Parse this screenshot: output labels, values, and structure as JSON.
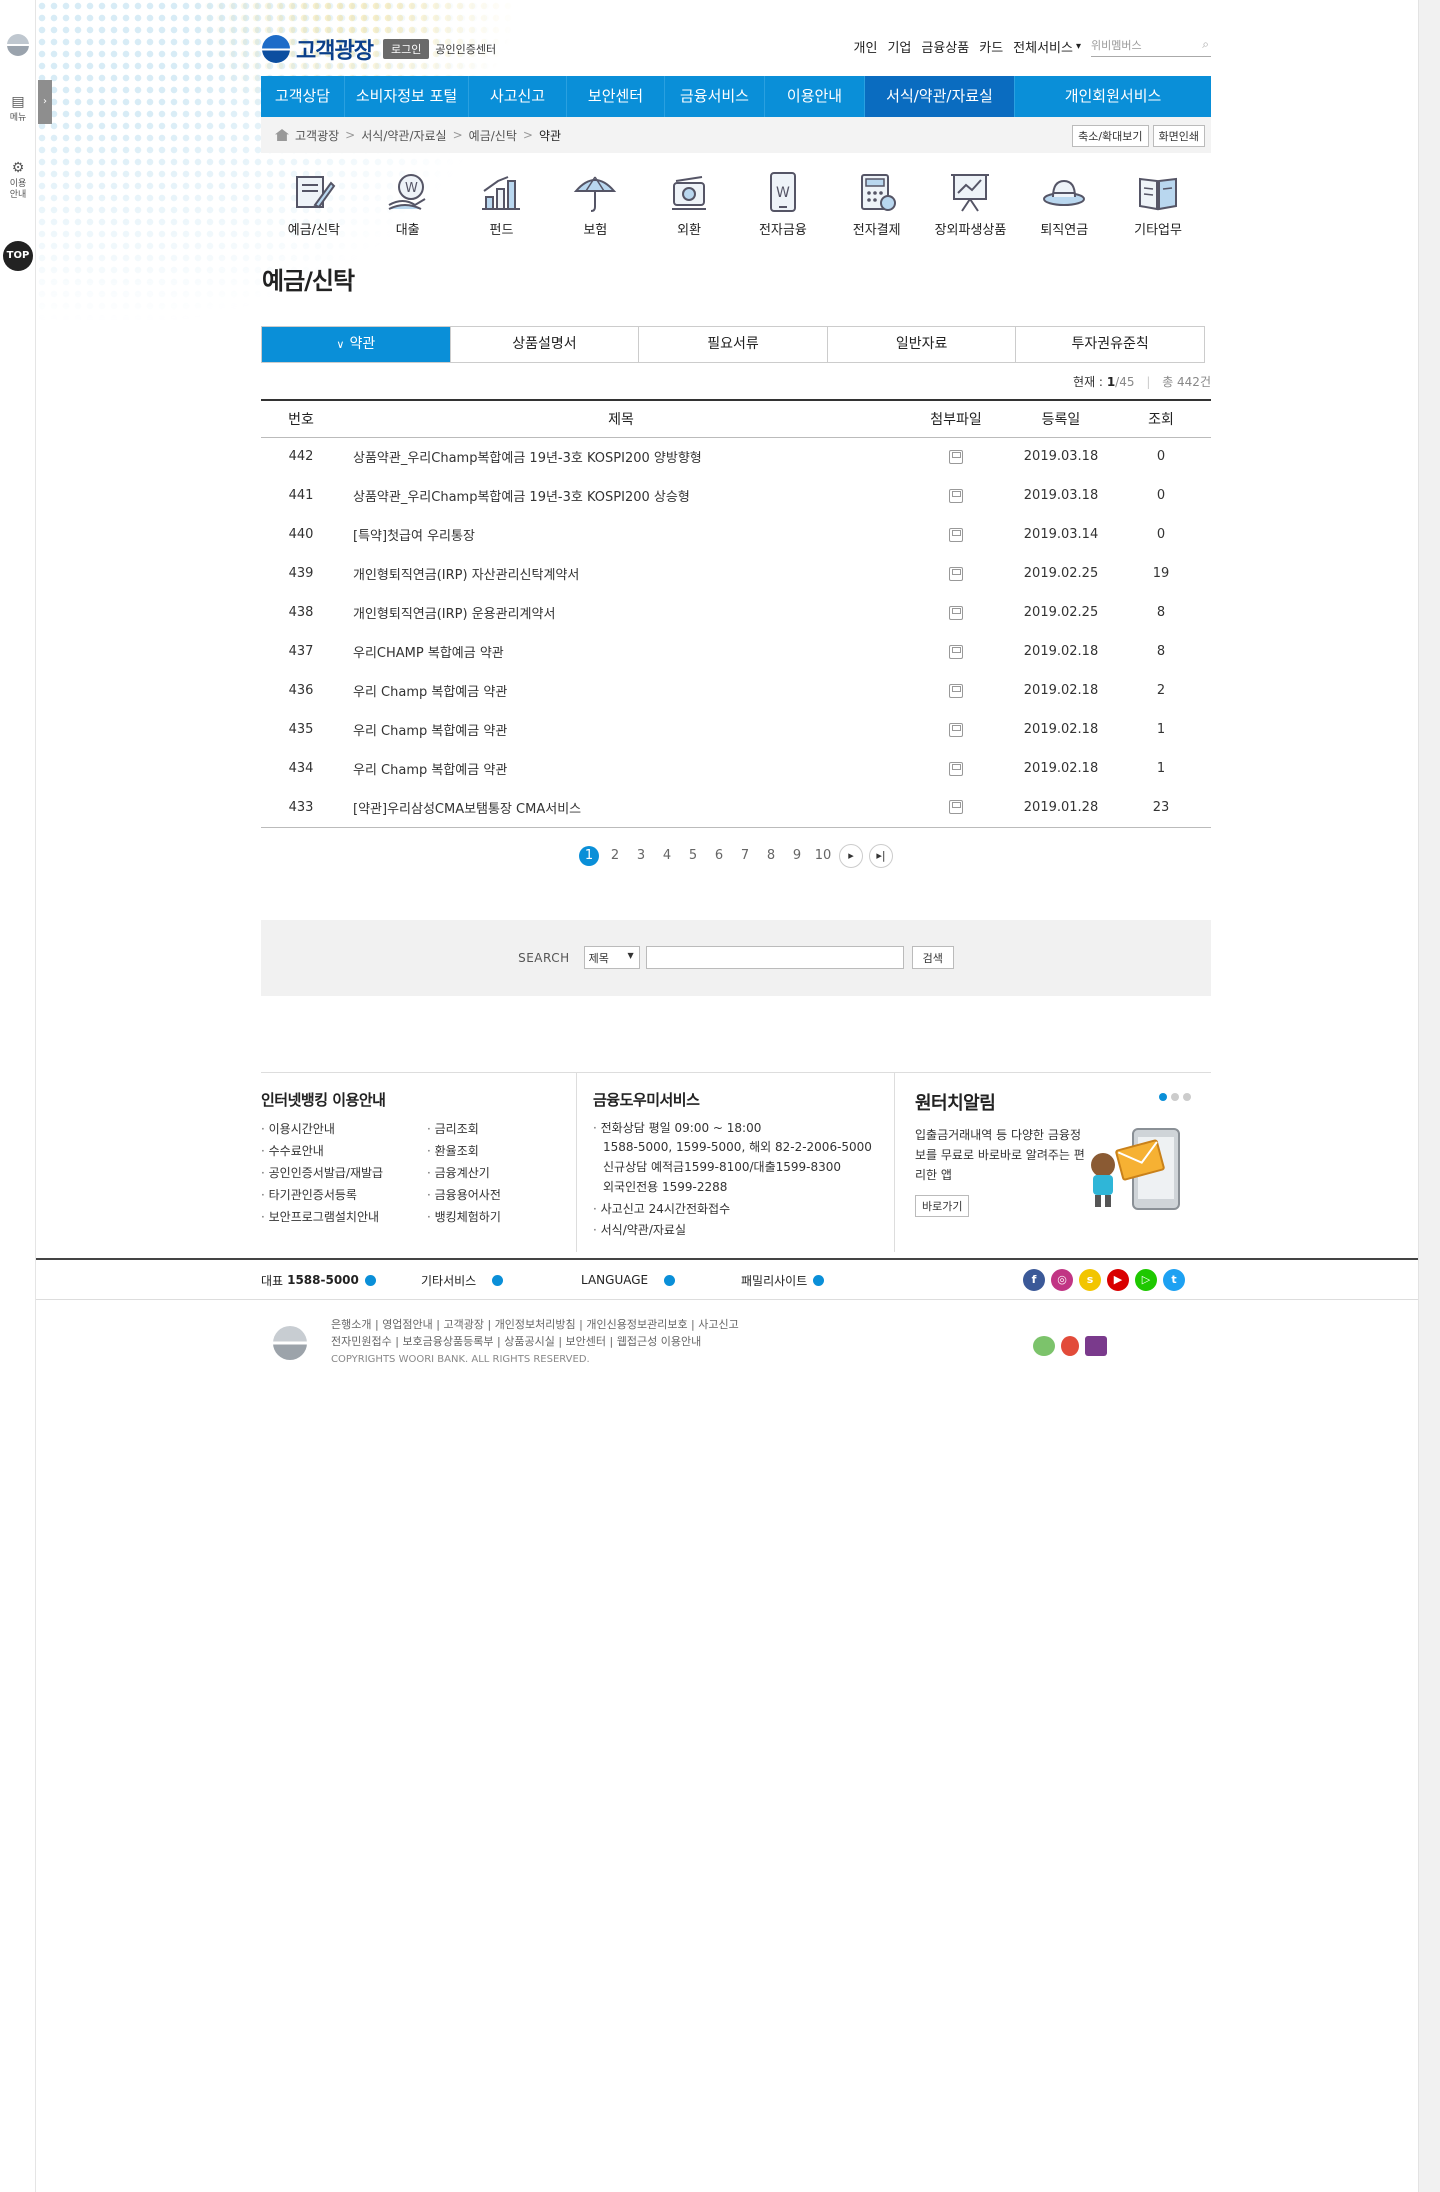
{
  "brand": {
    "logo_text": "고객광장",
    "login_label": "로그인",
    "cert_label": "공인인증센터"
  },
  "util_nav": {
    "items": [
      "개인",
      "기업",
      "금융상품",
      "카드",
      "전체서비스"
    ],
    "dropdown_caret": "▾",
    "search_placeholder": "위비멤버스"
  },
  "gnb": {
    "items": [
      "고객상담",
      "소비자정보 포털",
      "사고신고",
      "보안센터",
      "금융서비스",
      "이용안내",
      "서식/약관/자료실",
      "개인회원서비스"
    ],
    "active_index": 6,
    "active_color": "#0a6cc0",
    "bar_color": "#0a8fd8"
  },
  "breadcrumb": {
    "items": [
      "고객광장",
      "서식/약관/자료실",
      "예금/신탁",
      "약관"
    ],
    "separator": ">",
    "zoom_label": "축소/확대보기",
    "print_label": "화면인쇄"
  },
  "left_rail": {
    "menu_label": "메뉴",
    "guide_label": "이용 안내",
    "top_label": "TOP",
    "toggle": "›"
  },
  "categories": [
    {
      "label": "예금/신탁",
      "icon": "deposit-icon"
    },
    {
      "label": "대출",
      "icon": "loan-icon"
    },
    {
      "label": "펀드",
      "icon": "fund-icon"
    },
    {
      "label": "보험",
      "icon": "insurance-icon"
    },
    {
      "label": "외환",
      "icon": "forex-icon"
    },
    {
      "label": "전자금융",
      "icon": "e-banking-icon"
    },
    {
      "label": "전자결제",
      "icon": "e-payment-icon"
    },
    {
      "label": "장외파생상품",
      "icon": "derivatives-icon"
    },
    {
      "label": "퇴직연금",
      "icon": "pension-icon"
    },
    {
      "label": "기타업무",
      "icon": "other-work-icon"
    }
  ],
  "page_title": "예금/신탁",
  "tabs": {
    "items": [
      "약관",
      "상품설명서",
      "필요서류",
      "일반자료",
      "투자권유준칙"
    ],
    "active_index": 0,
    "active_marker": "∨"
  },
  "count": {
    "current_label": "현재 :",
    "current_page": "1",
    "total_pages": "/45",
    "total_label": "총 442건"
  },
  "table": {
    "headers": [
      "번호",
      "제목",
      "첨부파일",
      "등록일",
      "조회"
    ],
    "rows": [
      {
        "num": "442",
        "title": "상품약관_우리Champ복합예금 19년-3호 KOSPI200 양방향형",
        "date": "2019.03.18",
        "views": "0"
      },
      {
        "num": "441",
        "title": "상품약관_우리Champ복합예금 19년-3호 KOSPI200 상승형",
        "date": "2019.03.18",
        "views": "0"
      },
      {
        "num": "440",
        "title": "[특약]첫급여 우리통장",
        "date": "2019.03.14",
        "views": "0"
      },
      {
        "num": "439",
        "title": "개인형퇴직연금(IRP) 자산관리신탁계약서",
        "date": "2019.02.25",
        "views": "19"
      },
      {
        "num": "438",
        "title": "개인형퇴직연금(IRP) 운용관리계약서",
        "date": "2019.02.25",
        "views": "8"
      },
      {
        "num": "437",
        "title": "우리CHAMP 복합예금 약관",
        "date": "2019.02.18",
        "views": "8"
      },
      {
        "num": "436",
        "title": "우리 Champ 복합예금 약관",
        "date": "2019.02.18",
        "views": "2"
      },
      {
        "num": "435",
        "title": "우리 Champ 복합예금 약관",
        "date": "2019.02.18",
        "views": "1"
      },
      {
        "num": "434",
        "title": "우리 Champ 복합예금 약관",
        "date": "2019.02.18",
        "views": "1"
      },
      {
        "num": "433",
        "title": "[약관]우리삼성CMA보탬통장 CMA서비스",
        "date": "2019.01.28",
        "views": "23"
      }
    ]
  },
  "pager": {
    "pages": [
      "1",
      "2",
      "3",
      "4",
      "5",
      "6",
      "7",
      "8",
      "9",
      "10"
    ],
    "current": "1",
    "next": "▸",
    "last": "▸|"
  },
  "search": {
    "label": "SEARCH",
    "select_value": "제목",
    "caret": "▼",
    "button": "검색"
  },
  "info": {
    "banking_title": "인터넷뱅킹 이용안내",
    "banking_links": [
      "이용시간안내",
      "금리조회",
      "수수료안내",
      "환율조회",
      "공인인증서발급/재발급",
      "금융계산기",
      "타기관인증서등록",
      "금융용어사전",
      "보안프로그램설치안내",
      "뱅킹체험하기"
    ],
    "helper_title": "금융도우미서비스",
    "helper_phone_title": "전화상담 평일 09:00 ~ 18:00",
    "helper_phone_lines": [
      "1588-5000, 1599-5000, 해외 82-2-2006-5000",
      "신규상담 예적금1599-8100/대출1599-8300",
      "외국인전용 1599-2288"
    ],
    "helper_accident": "사고신고 24시간전화접수",
    "helper_forms": "서식/약관/자료실",
    "alarm_title": "원터치알림",
    "alarm_text": "입출금거래내역 등 다양한 금융정보를 무료로 바로바로 알려주는 편리한 앱",
    "alarm_button": "바로가기"
  },
  "footer_bar": {
    "rep_label": "대표",
    "rep_phone": "1588-5000",
    "other_label": "기타서비스",
    "language_label": "LANGUAGE",
    "family_label": "패밀리사이트",
    "sns": [
      {
        "name": "facebook-icon",
        "glyph": "f",
        "color": "#3b5998"
      },
      {
        "name": "instagram-icon",
        "glyph": "◎",
        "color": "#c13584"
      },
      {
        "name": "kakaostory-icon",
        "glyph": "s",
        "color": "#f2c500"
      },
      {
        "name": "youtube-icon",
        "glyph": "▶",
        "color": "#d90000"
      },
      {
        "name": "naver-tv-icon",
        "glyph": "▷",
        "color": "#1ec800"
      },
      {
        "name": "twitter-icon",
        "glyph": "t",
        "color": "#1da1f2"
      }
    ]
  },
  "footer": {
    "links_row1": [
      "은행소개",
      "영업점안내",
      "고객광장",
      "개인정보처리방침",
      "개인신용정보관리보호",
      "사고신고"
    ],
    "links_row2": [
      "전자민원접수",
      "보호금융상품등록부",
      "상품공시실",
      "보안센터",
      "웹접근성 이용안내"
    ],
    "copyright": "COPYRIGHTS WOORI BANK. ALL RIGHTS RESERVED."
  }
}
